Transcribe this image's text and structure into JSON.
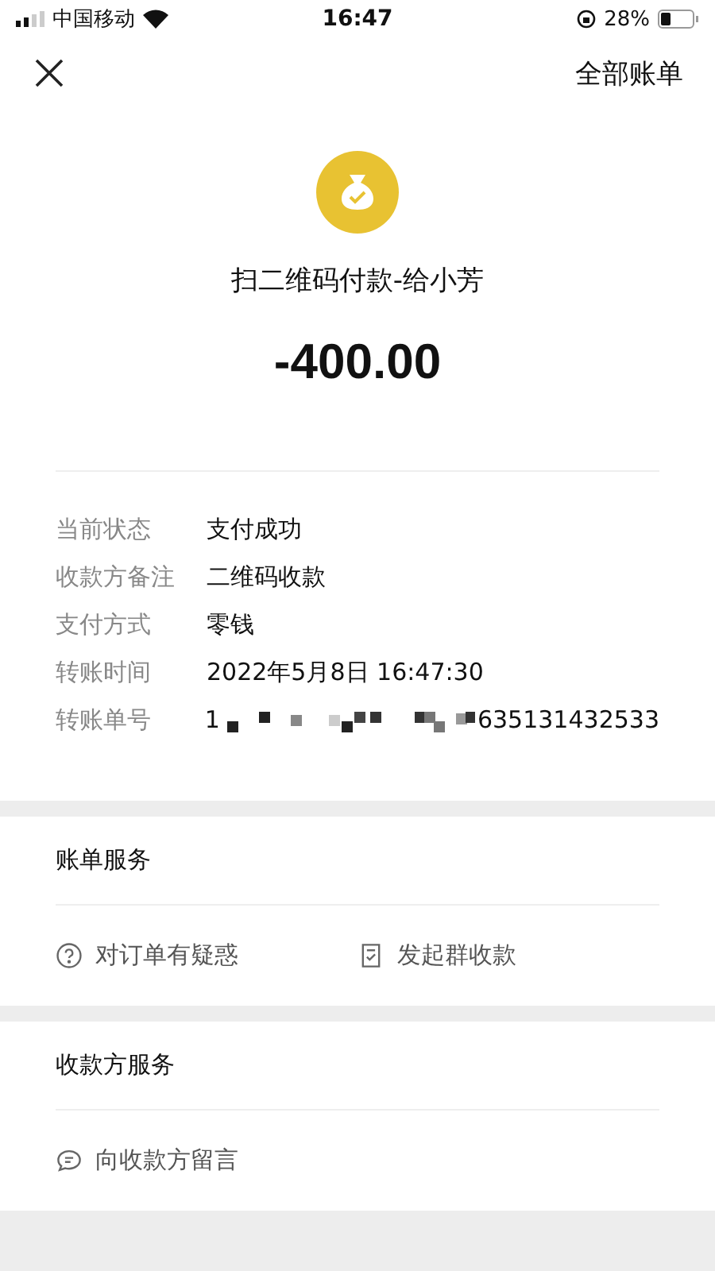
{
  "status_bar": {
    "carrier": "中国移动",
    "time": "16:47",
    "battery": "28%"
  },
  "nav": {
    "right": "全部账单"
  },
  "summary": {
    "title": "扫二维码付款-给小芳",
    "amount": "-400.00"
  },
  "details": [
    {
      "label": "当前状态",
      "value": "支付成功"
    },
    {
      "label": "收款方备注",
      "value": "二维码收款"
    },
    {
      "label": "支付方式",
      "value": "零钱"
    },
    {
      "label": "转账时间",
      "value": "2022年5月8日 16:47:30"
    },
    {
      "label": "转账单号",
      "value_start": "1",
      "value_end": "635131432533"
    }
  ],
  "sections": [
    {
      "title": "账单服务",
      "actions": [
        {
          "kind": "question",
          "label": "对订单有疑惑"
        },
        {
          "kind": "document",
          "label": "发起群收款"
        }
      ]
    },
    {
      "title": "收款方服务",
      "actions": [
        {
          "kind": "message",
          "label": "向收款方留言"
        }
      ]
    }
  ]
}
